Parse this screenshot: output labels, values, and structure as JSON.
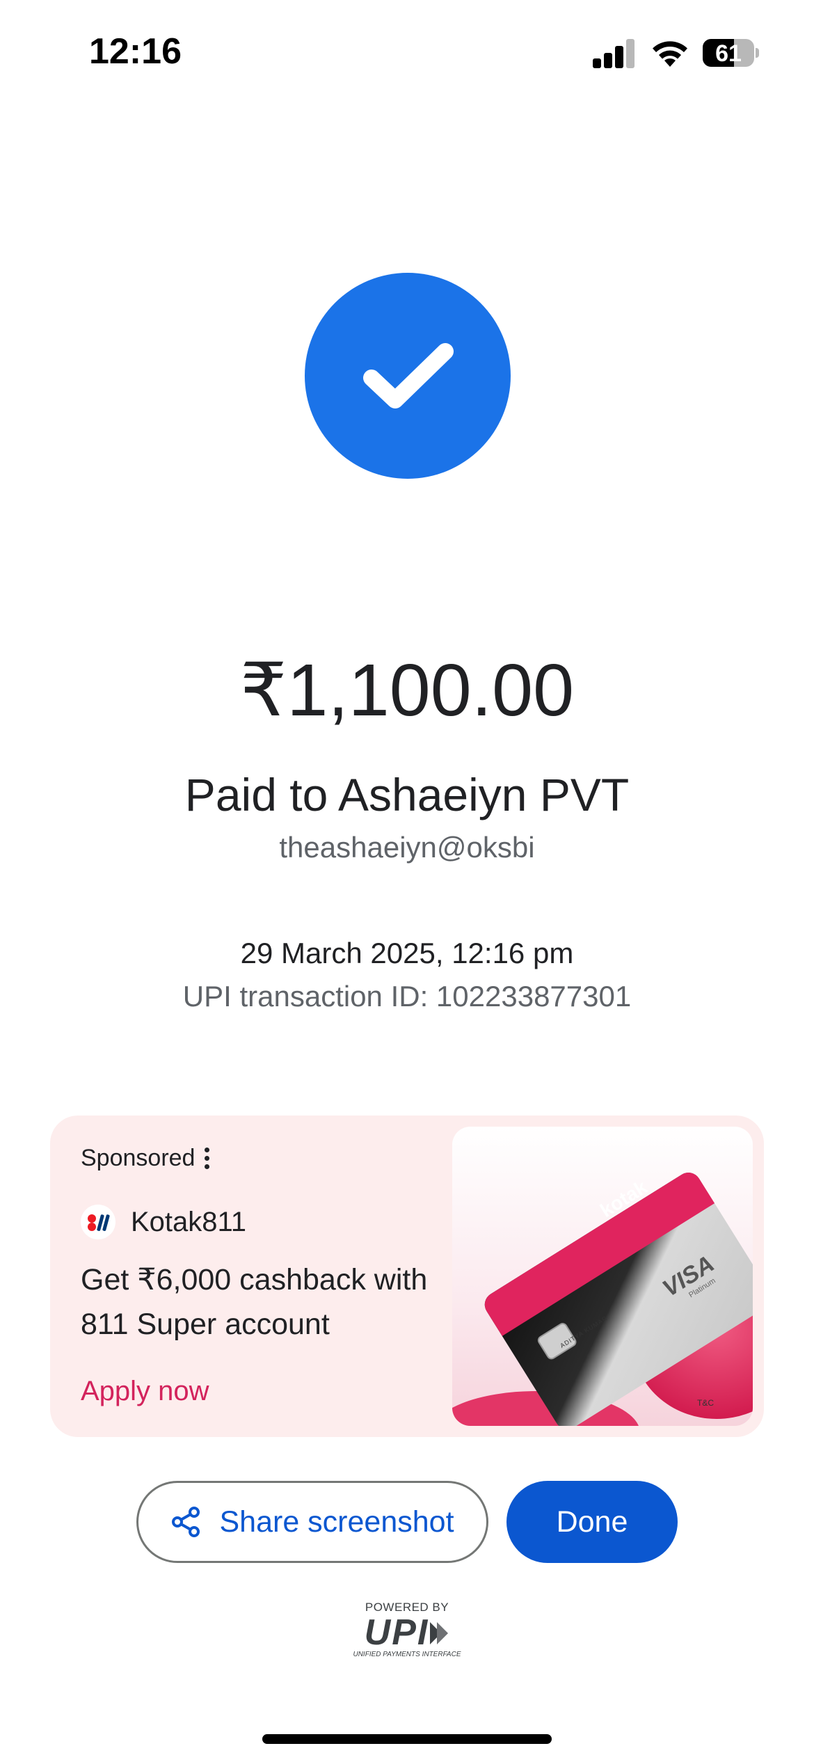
{
  "status_bar": {
    "time": "12:16",
    "battery": "61",
    "battery_level": 0.61,
    "icons": [
      "cellular-signal-icon",
      "wifi-icon",
      "battery-icon"
    ]
  },
  "payment": {
    "status_icon": "check-icon",
    "amount": "₹1,100.00",
    "paid_to": "Paid to Ashaeiyn PVT",
    "upi_id": "theashaeiyn@oksbi",
    "datetime": "29 March 2025, 12:16 pm",
    "transaction_id": "UPI transaction ID: 102233877301"
  },
  "ad": {
    "sponsored_label": "Sponsored",
    "brand": "Kotak811",
    "headline": "Get ₹6,000 cashback with 811 Super account",
    "cta": "Apply now",
    "image": {
      "card_brand": "kotak",
      "card_network": "VISA",
      "card_tier": "Platinum",
      "cardholder": "ADITYA KUMAR",
      "tnc": "T&C"
    }
  },
  "actions": {
    "share_label": "Share screenshot",
    "done_label": "Done"
  },
  "footer": {
    "powered_by": "POWERED BY",
    "logo": "UPI",
    "logo_sub": "UNIFIED PAYMENTS INTERFACE"
  },
  "colors": {
    "success": "#1b73e8",
    "primary_button": "#0b57d0",
    "ad_background": "#fdeded",
    "ad_cta": "#d3235c"
  }
}
